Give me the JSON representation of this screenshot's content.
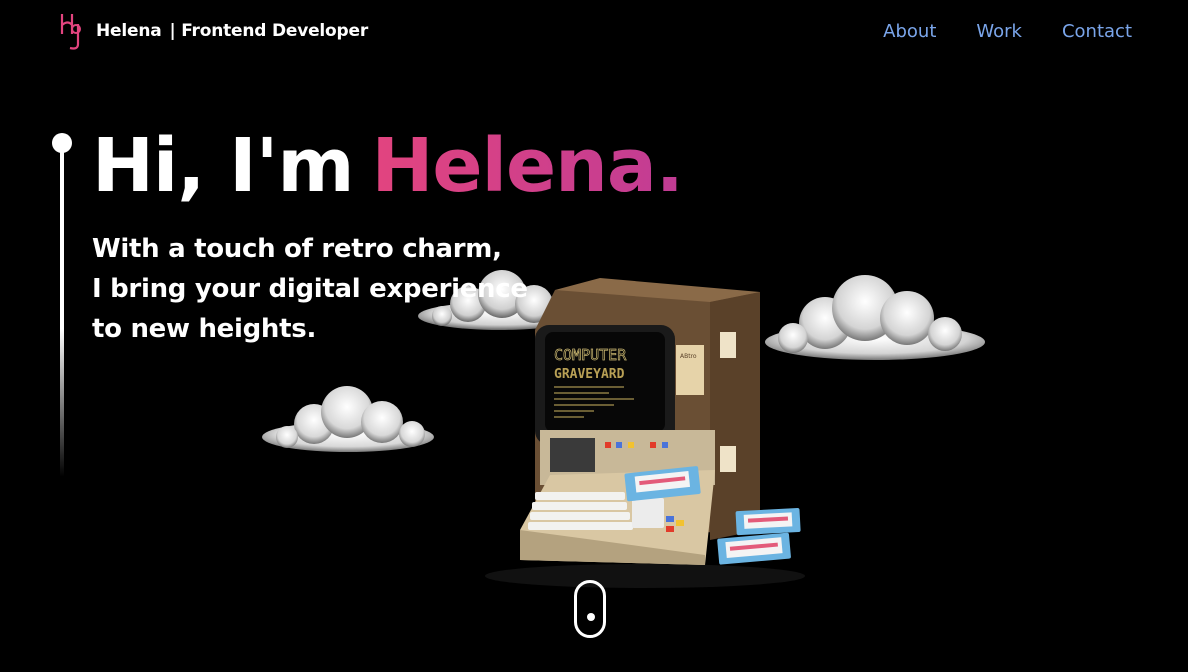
{
  "nav": {
    "brand_name": "Helena",
    "brand_title": "| Frontend Developer",
    "links": [
      {
        "label": "About"
      },
      {
        "label": "Work"
      },
      {
        "label": "Contact"
      }
    ]
  },
  "hero": {
    "greeting": "Hi, I'm",
    "name": "Helena.",
    "tagline": [
      "With a touch of retro charm,",
      "I bring your digital experience",
      "to new heights."
    ]
  },
  "computer_screen": {
    "line1": "COMPUTER",
    "line2": "GRAVEYARD"
  },
  "computer_badge": "ABtro",
  "colors": {
    "background": "#000000",
    "nav_link": "#7aa5ea",
    "accent_start": "#e2447f",
    "accent_end": "#c13c94"
  },
  "icons": {
    "logo": "hg-monogram-icon",
    "scroll": "mouse-scroll-icon"
  }
}
